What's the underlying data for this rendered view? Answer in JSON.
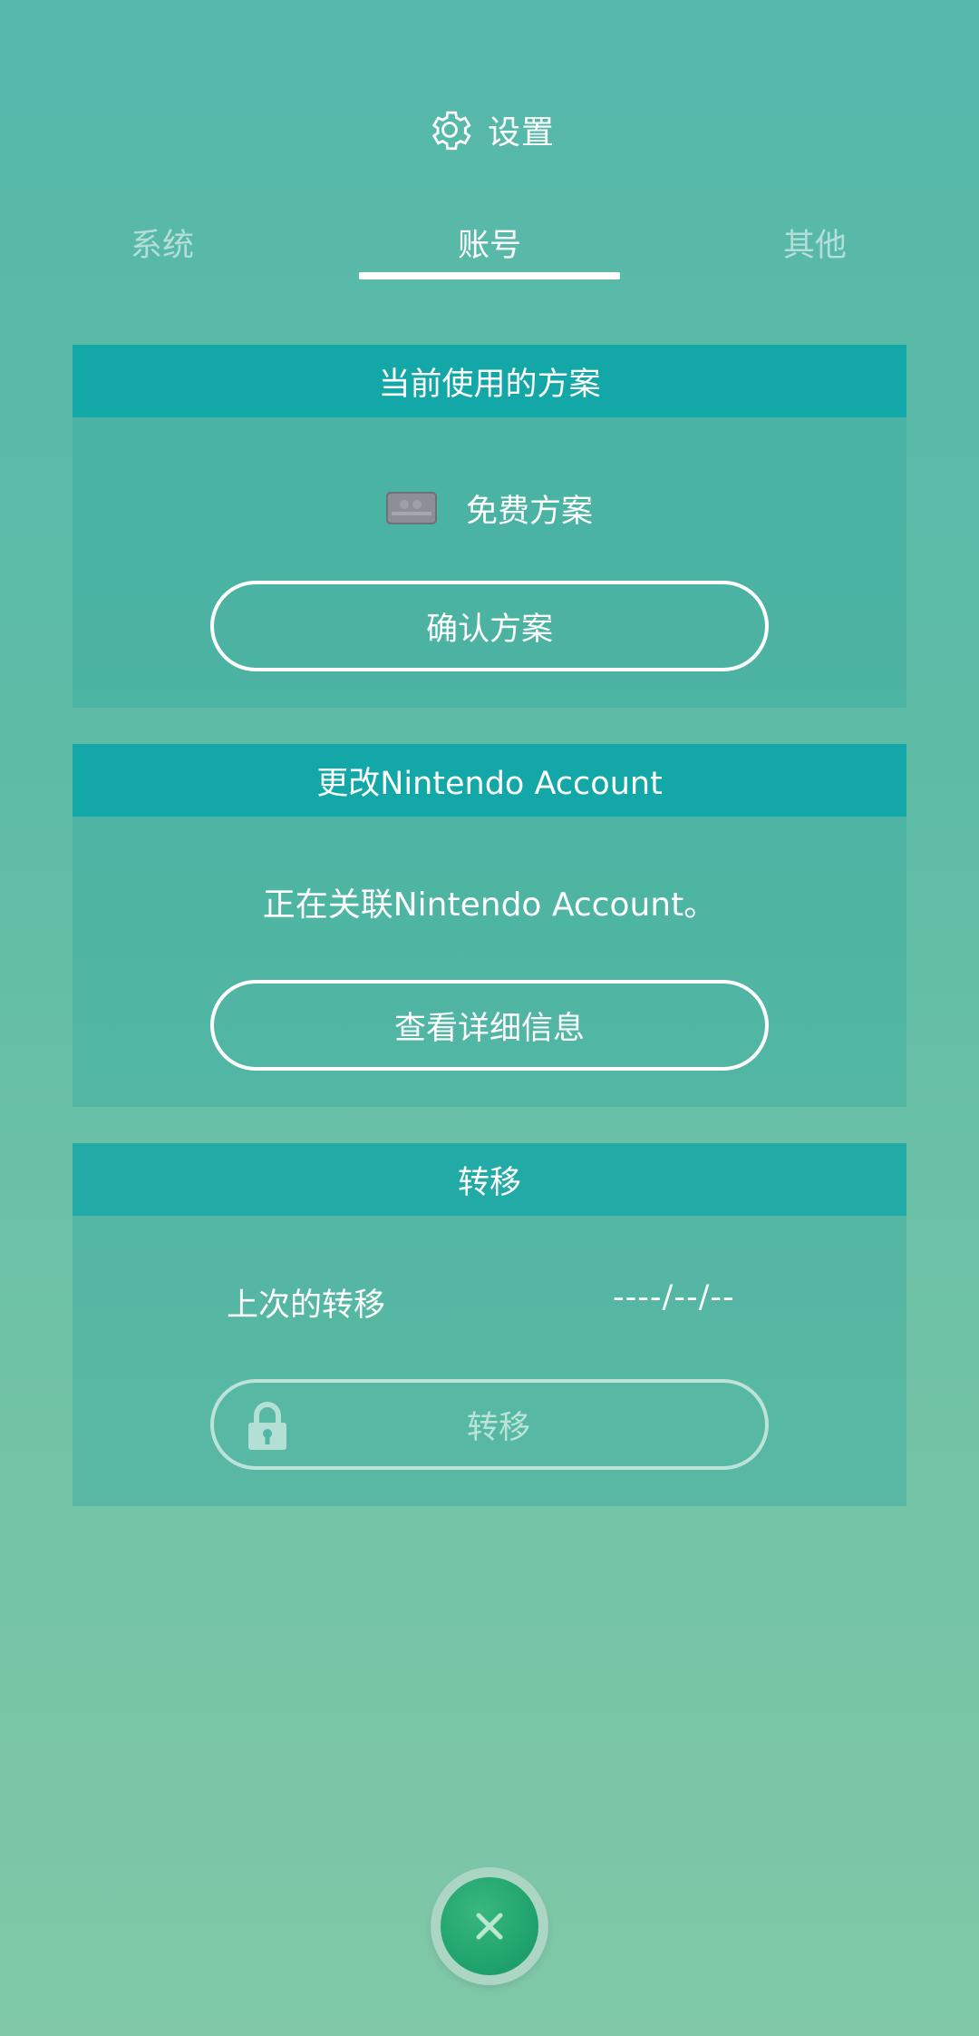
{
  "header": {
    "title": "设置",
    "icon": "gear-icon"
  },
  "tabs": [
    {
      "label": "系统",
      "active": false
    },
    {
      "label": "账号",
      "active": true
    },
    {
      "label": "其他",
      "active": false
    }
  ],
  "plan_section": {
    "title": "当前使用的方案",
    "plan_name": "免费方案",
    "plan_icon": "membership-card-icon",
    "button_label": "确认方案"
  },
  "account_section": {
    "title": "更改Nintendo Account",
    "status_text": "正在关联Nintendo Account。",
    "button_label": "查看详细信息"
  },
  "transfer_section": {
    "title": "转移",
    "last_transfer_label": "上次的转移",
    "last_transfer_date": "----/--/--",
    "button_label": "转移",
    "button_icon": "lock-icon"
  },
  "close_button": {
    "icon": "close-icon"
  },
  "colors": {
    "section_header": "#13a7a8",
    "close_button": "#21a46e",
    "background_top": "#55b8aa",
    "background_bottom": "#80c8a7"
  }
}
